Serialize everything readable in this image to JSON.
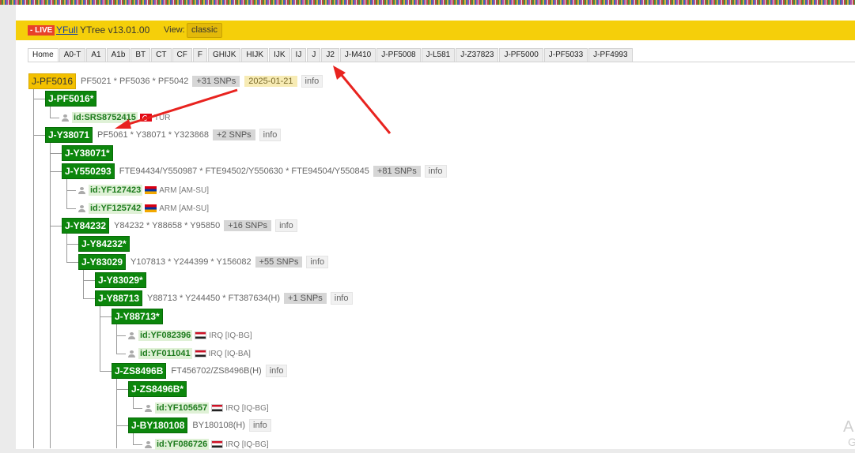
{
  "header": {
    "live_badge": "- LIVE",
    "brand_link": "YFull",
    "brand_rest": "YTree v13.01.00",
    "view_label": "View:",
    "view_button": "classic",
    "accent_color": "#f5cf0a"
  },
  "tabs": [
    "Home",
    "A0-T",
    "A1",
    "A1b",
    "BT",
    "CT",
    "CF",
    "F",
    "GHIJK",
    "HIJK",
    "IJK",
    "IJ",
    "J",
    "J2",
    "J-M410",
    "J-PF5008",
    "J-L581",
    "J-Z37823",
    "J-PF5000",
    "J-PF5033",
    "J-PF4993"
  ],
  "active_tab": "Home",
  "tree": {
    "root": {
      "label": "J-PF5016",
      "snps": "PF5021 * PF5036 * PF5042",
      "count": "+31 SNPs",
      "date": "2025-01-21",
      "info": "info"
    },
    "n1": {
      "label": "J-PF5016*"
    },
    "s1": {
      "id": "id:SRS8752415",
      "loc": "TUR"
    },
    "n2": {
      "label": "J-Y38071",
      "snps": "PF5061 * Y38071 * Y323868",
      "count": "+2 SNPs",
      "info": "info"
    },
    "n3": {
      "label": "J-Y38071*"
    },
    "n4": {
      "label": "J-Y550293",
      "snps": "FTE94434/Y550987 * FTE94502/Y550630 * FTE94504/Y550845",
      "count": "+81 SNPs",
      "info": "info"
    },
    "s2": {
      "id": "id:YF127423",
      "loc": "ARM [AM-SU]"
    },
    "s3": {
      "id": "id:YF125742",
      "loc": "ARM [AM-SU]"
    },
    "n5": {
      "label": "J-Y84232",
      "snps": "Y84232 * Y88658 * Y95850",
      "count": "+16 SNPs",
      "info": "info"
    },
    "n6": {
      "label": "J-Y84232*"
    },
    "n7": {
      "label": "J-Y83029",
      "snps": "Y107813 * Y244399 * Y156082",
      "count": "+55 SNPs",
      "info": "info"
    },
    "n8": {
      "label": "J-Y83029*"
    },
    "n9": {
      "label": "J-Y88713",
      "snps": "Y88713 * Y244450 * FT387634(H)",
      "count": "+1 SNPs",
      "info": "info"
    },
    "n10": {
      "label": "J-Y88713*"
    },
    "s4": {
      "id": "id:YF082396",
      "loc": "IRQ [IQ-BG]"
    },
    "s5": {
      "id": "id:YF011041",
      "loc": "IRQ [IQ-BA]"
    },
    "n11": {
      "label": "J-ZS8496B",
      "snps": "FT456702/ZS8496B(H)",
      "info": "info"
    },
    "n12": {
      "label": "J-ZS8496B*"
    },
    "s6": {
      "id": "id:YF105657",
      "loc": "IRQ [IQ-BG]"
    },
    "n13": {
      "label": "J-BY180108",
      "snps": "BY180108(H)",
      "info": "info"
    },
    "s7": {
      "id": "id:YF086726",
      "loc": "IRQ [IQ-BG]"
    }
  },
  "annotations": {
    "arrow_color": "#e8231f"
  },
  "corner_text": {
    "a": "A",
    "b": "G"
  }
}
